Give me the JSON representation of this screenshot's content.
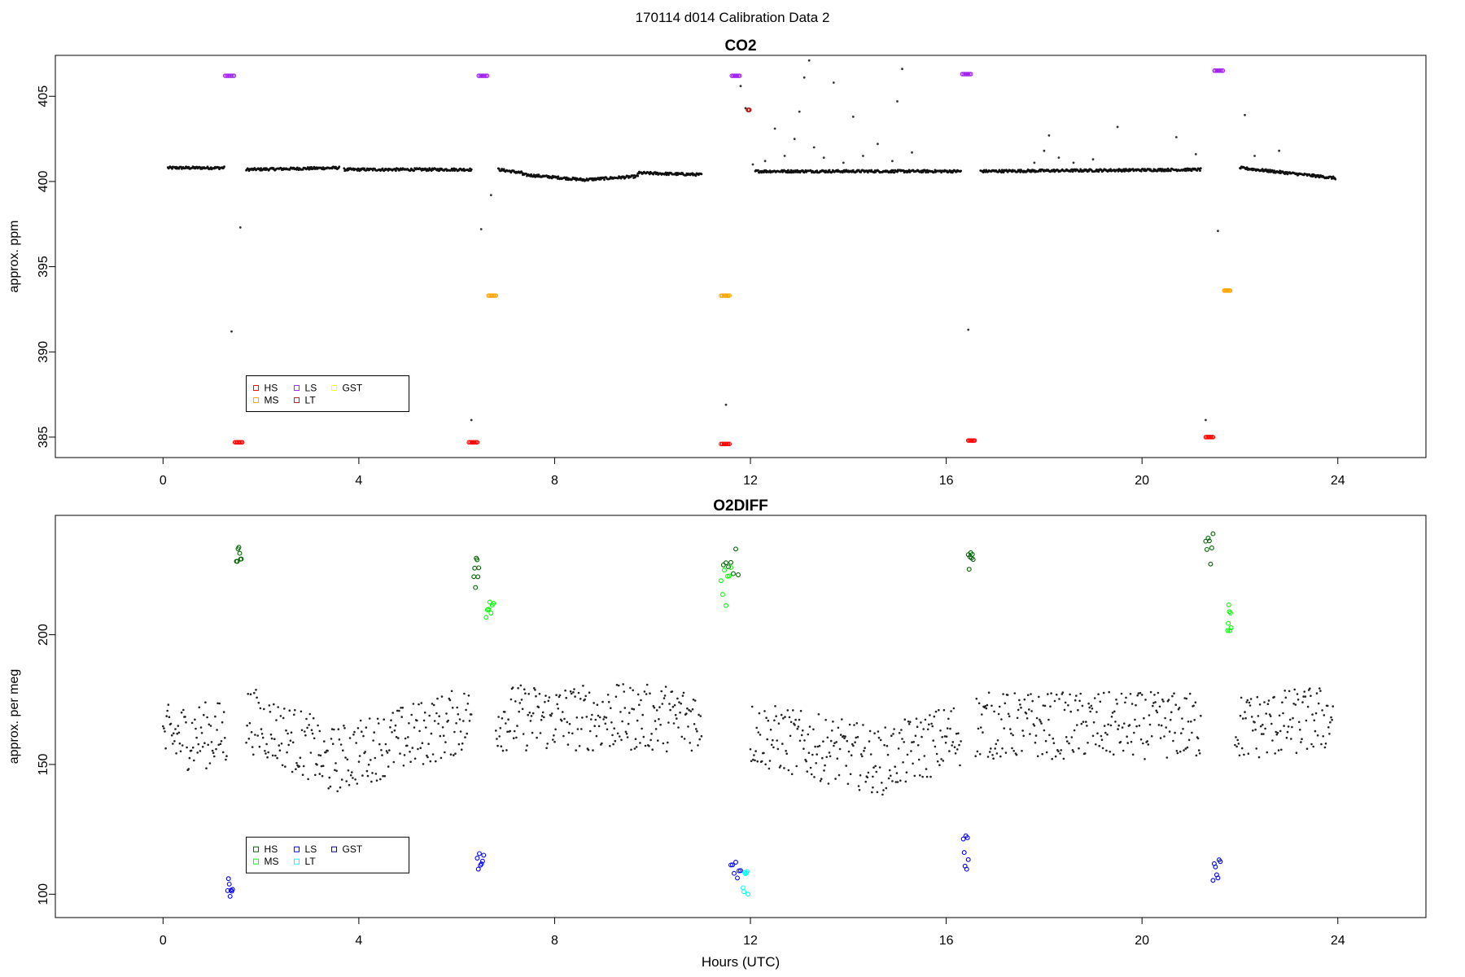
{
  "page": {
    "suptitle": "170114   d014   Calibration Data 2"
  },
  "chart_data": [
    {
      "type": "scatter",
      "title": "CO2",
      "xlabel": "",
      "ylabel": "approx. ppm",
      "xlim": [
        -2.2,
        25.8
      ],
      "ylim": [
        383.8,
        407.4
      ],
      "xticks": [
        0,
        4,
        8,
        12,
        16,
        20,
        24
      ],
      "yticks": [
        385,
        390,
        395,
        400,
        405
      ],
      "grid": false,
      "legend": {
        "placement": "bottom-left",
        "entries": [
          {
            "label": "HS",
            "color": "#ff0000"
          },
          {
            "label": "MS",
            "color": "#ffa500"
          },
          {
            "label": "LS",
            "color": "#a020f0"
          },
          {
            "label": "LT",
            "color": "#b22222"
          },
          {
            "label": "GST",
            "color": "#ffff00"
          }
        ]
      },
      "baseline_segments": [
        {
          "x": [
            0.1,
            1.25
          ],
          "y": [
            400.8,
            400.8
          ]
        },
        {
          "x": [
            1.7,
            3.6
          ],
          "y": [
            400.7,
            400.8
          ]
        },
        {
          "x": [
            3.7,
            6.3
          ],
          "y": [
            400.7,
            400.7
          ]
        },
        {
          "x": [
            6.85,
            7.35
          ],
          "y": [
            400.7,
            400.5
          ]
        },
        {
          "x": [
            7.35,
            8.6
          ],
          "y": [
            400.4,
            400.1
          ]
        },
        {
          "x": [
            8.6,
            9.7
          ],
          "y": [
            400.1,
            400.3
          ]
        },
        {
          "x": [
            9.7,
            11.0
          ],
          "y": [
            400.5,
            400.4
          ]
        },
        {
          "x": [
            12.1,
            16.3
          ],
          "y": [
            400.6,
            400.6
          ]
        },
        {
          "x": [
            16.7,
            21.2
          ],
          "y": [
            400.6,
            400.7
          ]
        },
        {
          "x": [
            22.0,
            23.95
          ],
          "y": [
            400.8,
            400.2
          ]
        }
      ],
      "scatter_points": [
        {
          "x": 12.3,
          "y": 401.2
        },
        {
          "x": 12.5,
          "y": 403.1
        },
        {
          "x": 12.7,
          "y": 401.5
        },
        {
          "x": 12.9,
          "y": 402.5
        },
        {
          "x": 13.0,
          "y": 404.1
        },
        {
          "x": 13.1,
          "y": 406.1
        },
        {
          "x": 13.2,
          "y": 407.1
        },
        {
          "x": 13.3,
          "y": 402.0
        },
        {
          "x": 13.5,
          "y": 401.4
        },
        {
          "x": 13.7,
          "y": 405.8
        },
        {
          "x": 13.9,
          "y": 401.1
        },
        {
          "x": 14.1,
          "y": 403.8
        },
        {
          "x": 14.3,
          "y": 401.5
        },
        {
          "x": 14.6,
          "y": 402.2
        },
        {
          "x": 14.9,
          "y": 401.2
        },
        {
          "x": 15.1,
          "y": 406.6
        },
        {
          "x": 15.3,
          "y": 401.7
        },
        {
          "x": 15.0,
          "y": 404.7
        },
        {
          "x": 17.8,
          "y": 401.1
        },
        {
          "x": 18.0,
          "y": 401.8
        },
        {
          "x": 18.1,
          "y": 402.7
        },
        {
          "x": 18.3,
          "y": 401.4
        },
        {
          "x": 18.6,
          "y": 401.1
        },
        {
          "x": 19.0,
          "y": 401.3
        },
        {
          "x": 19.5,
          "y": 403.2
        },
        {
          "x": 20.7,
          "y": 402.6
        },
        {
          "x": 21.1,
          "y": 401.6
        },
        {
          "x": 22.1,
          "y": 403.9
        },
        {
          "x": 22.3,
          "y": 401.5
        },
        {
          "x": 22.8,
          "y": 401.8
        },
        {
          "x": 11.8,
          "y": 405.6
        },
        {
          "x": 11.9,
          "y": 404.3
        },
        {
          "x": 12.05,
          "y": 401.0
        },
        {
          "x": 6.5,
          "y": 397.2
        },
        {
          "x": 6.7,
          "y": 399.2
        },
        {
          "x": 1.58,
          "y": 397.3
        },
        {
          "x": 1.4,
          "y": 391.2
        },
        {
          "x": 11.5,
          "y": 386.9
        },
        {
          "x": 16.45,
          "y": 391.3
        },
        {
          "x": 21.55,
          "y": 397.1
        },
        {
          "x": 6.3,
          "y": 386.0
        },
        {
          "x": 21.3,
          "y": 386.0
        }
      ],
      "calibration_series": [
        {
          "name": "LS",
          "color": "#a020f0",
          "x": [
            1.27,
            1.45
          ],
          "y": 406.2
        },
        {
          "name": "LS",
          "color": "#a020f0",
          "x": [
            6.45,
            6.62
          ],
          "y": 406.2
        },
        {
          "name": "LS",
          "color": "#a020f0",
          "x": [
            11.62,
            11.78
          ],
          "y": 406.2
        },
        {
          "name": "LS",
          "color": "#a020f0",
          "x": [
            16.33,
            16.5
          ],
          "y": 406.3
        },
        {
          "name": "LS",
          "color": "#a020f0",
          "x": [
            21.48,
            21.65
          ],
          "y": 406.5
        },
        {
          "name": "HS",
          "color": "#ff0000",
          "x": [
            1.47,
            1.62
          ],
          "y": 384.7
        },
        {
          "name": "HS",
          "color": "#ff0000",
          "x": [
            6.25,
            6.42
          ],
          "y": 384.7
        },
        {
          "name": "HS",
          "color": "#ff0000",
          "x": [
            11.4,
            11.57
          ],
          "y": 384.6
        },
        {
          "name": "HS",
          "color": "#ff0000",
          "x": [
            16.45,
            16.58
          ],
          "y": 384.8
        },
        {
          "name": "HS",
          "color": "#ff0000",
          "x": [
            21.3,
            21.45
          ],
          "y": 385.0
        },
        {
          "name": "MS",
          "color": "#ffa500",
          "x": [
            6.65,
            6.8
          ],
          "y": 393.3
        },
        {
          "name": "MS",
          "color": "#ffa500",
          "x": [
            11.4,
            11.57
          ],
          "y": 393.3
        },
        {
          "name": "MS",
          "color": "#ffa500",
          "x": [
            21.68,
            21.8
          ],
          "y": 393.6
        },
        {
          "name": "LT",
          "color": "#b22222",
          "x": [
            11.95,
            11.98
          ],
          "y": 404.2
        }
      ]
    },
    {
      "type": "scatter",
      "title": "O2DIFF",
      "xlabel": "Hours (UTC)",
      "ylabel": "approx. per meg",
      "xlim": [
        -2.2,
        25.8
      ],
      "ylim": [
        91,
        246
      ],
      "xticks": [
        0,
        4,
        8,
        12,
        16,
        20,
        24
      ],
      "yticks": [
        100,
        150,
        200
      ],
      "grid": false,
      "legend": {
        "placement": "bottom-left",
        "entries": [
          {
            "label": "HS",
            "color": "#006400"
          },
          {
            "label": "MS",
            "color": "#00ff00"
          },
          {
            "label": "LS",
            "color": "#0000ff"
          },
          {
            "label": "LT",
            "color": "#00ffff"
          },
          {
            "label": "GST",
            "color": "#00008b"
          }
        ]
      },
      "baseline_segments": [
        {
          "x": [
            0.0,
            1.3
          ],
          "y": [
            160,
            162
          ]
        },
        {
          "x": [
            1.7,
            3.2
          ],
          "y": [
            168,
            155
          ]
        },
        {
          "x": [
            3.2,
            6.3
          ],
          "y": [
            150,
            168
          ]
        },
        {
          "x": [
            6.8,
            11.0
          ],
          "y": [
            168,
            168
          ]
        },
        {
          "x": [
            12.0,
            14.5
          ],
          "y": [
            162,
            152
          ]
        },
        {
          "x": [
            14.5,
            16.3
          ],
          "y": [
            150,
            162
          ]
        },
        {
          "x": [
            16.6,
            21.2
          ],
          "y": [
            165,
            165
          ]
        },
        {
          "x": [
            21.9,
            23.9
          ],
          "y": [
            164,
            168
          ]
        }
      ],
      "calibration_series": [
        {
          "name": "HS",
          "color": "#006400",
          "x": [
            1.5,
            1.6
          ],
          "y": [
            234,
            226
          ]
        },
        {
          "name": "HS",
          "color": "#006400",
          "x": [
            6.35,
            6.45
          ],
          "y": [
            230,
            218
          ]
        },
        {
          "name": "HS",
          "color": "#006400",
          "x": [
            11.45,
            11.75
          ],
          "y": [
            220,
            235
          ]
        },
        {
          "name": "HS",
          "color": "#006400",
          "x": [
            16.45,
            16.55
          ],
          "y": [
            225,
            232
          ]
        },
        {
          "name": "HS",
          "color": "#006400",
          "x": [
            21.3,
            21.45
          ],
          "y": [
            227,
            240
          ]
        },
        {
          "name": "MS",
          "color": "#00ff00",
          "x": [
            6.6,
            6.75
          ],
          "y": [
            206,
            214
          ]
        },
        {
          "name": "MS",
          "color": "#00ff00",
          "x": [
            11.4,
            11.6
          ],
          "y": [
            210,
            226
          ]
        },
        {
          "name": "MS",
          "color": "#00ff00",
          "x": [
            21.75,
            21.82
          ],
          "y": [
            201,
            212
          ]
        },
        {
          "name": "LS",
          "color": "#0000ff",
          "x": [
            1.32,
            1.42
          ],
          "y": [
            97,
            109
          ]
        },
        {
          "name": "LS",
          "color": "#0000ff",
          "x": [
            6.42,
            6.55
          ],
          "y": [
            108,
            118
          ]
        },
        {
          "name": "LS",
          "color": "#0000ff",
          "x": [
            11.6,
            11.8
          ],
          "y": [
            106,
            117
          ]
        },
        {
          "name": "LS",
          "color": "#0000ff",
          "x": [
            16.35,
            16.45
          ],
          "y": [
            108,
            123
          ]
        },
        {
          "name": "LS",
          "color": "#0000ff",
          "x": [
            21.45,
            21.6
          ],
          "y": [
            105,
            114
          ]
        },
        {
          "name": "LT",
          "color": "#00ffff",
          "x": [
            11.85,
            11.95
          ],
          "y": [
            100,
            109
          ]
        }
      ]
    }
  ]
}
